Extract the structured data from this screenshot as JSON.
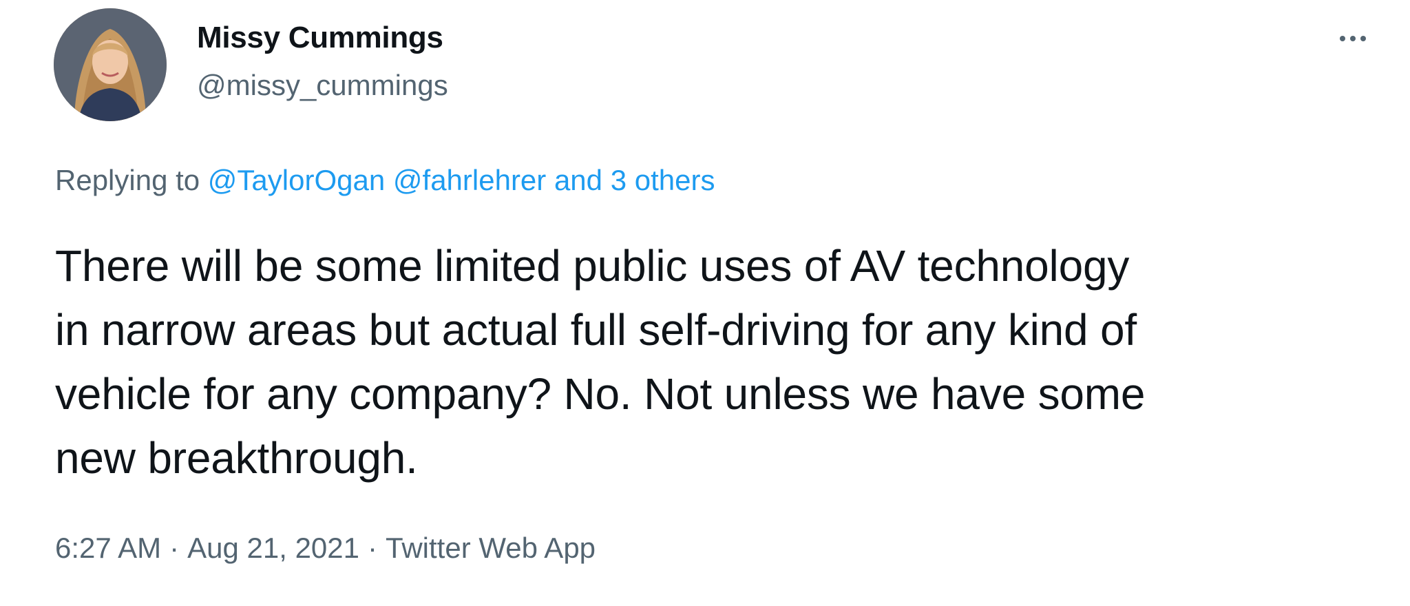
{
  "author": {
    "display_name": "Missy Cummings",
    "handle": "@missy_cummings",
    "avatar_icon": "profile-photo"
  },
  "reply": {
    "prefix": "Replying to",
    "mentions": [
      "@TaylorOgan",
      "@fahrlehrer"
    ],
    "others": "and 3 others"
  },
  "tweet": {
    "lines": [
      "There will be some limited public uses of AV technology",
      "in narrow areas but actual full self-driving for any kind of",
      "vehicle for any company? No. Not unless we have some",
      "new breakthrough."
    ]
  },
  "meta": {
    "time": "6:27 AM",
    "separator": "·",
    "date": "Aug 21, 2021",
    "source": "Twitter Web App"
  },
  "menu": {
    "icon": "more-options-icon"
  },
  "colors": {
    "text": "#0f1419",
    "secondary": "#536471",
    "link": "#1d9bf0"
  }
}
